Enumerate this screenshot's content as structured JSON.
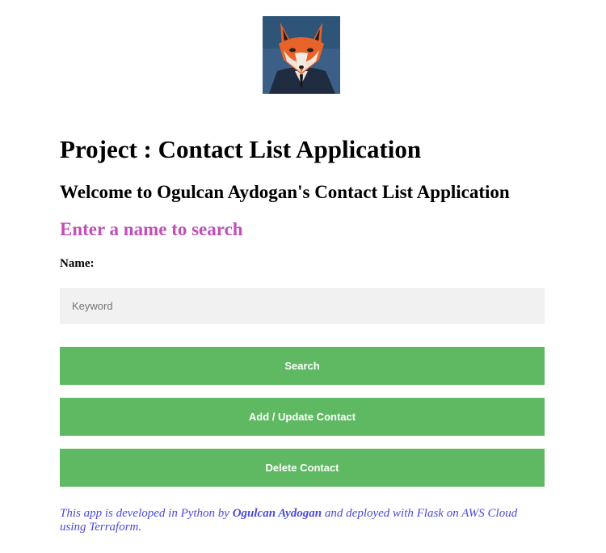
{
  "avatar": {
    "alt": "fox portrait",
    "colors": {
      "background": "#3b5f86",
      "fur": "#e8632a",
      "suit": "#1f2b3f"
    }
  },
  "header": {
    "title": "Project : Contact List Application",
    "welcome": "Welcome to Ogulcan Aydogan's Contact List Application",
    "search_heading": "Enter a name to search"
  },
  "form": {
    "name_label": "Name:",
    "keyword_placeholder": "Keyword",
    "keyword_value": ""
  },
  "buttons": {
    "search": "Search",
    "add_update": "Add / Update Contact",
    "delete": "Delete Contact"
  },
  "footer": {
    "text_before": "This app is developed in Python by ",
    "author": "Ogulcan Aydogan",
    "text_after": " and deployed with Flask on AWS Cloud using Terraform."
  },
  "colors": {
    "button_bg": "#5fb962",
    "accent_heading": "#c04fb6",
    "footer_text": "#4a4ae0",
    "input_bg": "#f1f1f1"
  }
}
